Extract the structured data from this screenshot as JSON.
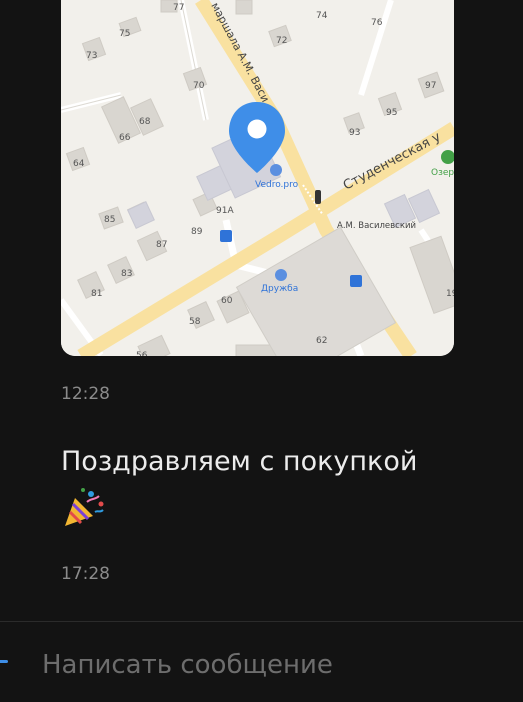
{
  "messages": [
    {
      "type": "location",
      "time": "12:28",
      "map": {
        "street_label": "Студенческая у",
        "vertical_street_label": "маршала А.М. Васи",
        "houses": [
          "77",
          "74",
          "76",
          "75",
          "73",
          "72",
          "70",
          "97",
          "68",
          "66",
          "95",
          "93",
          "64",
          "85",
          "91A",
          "89",
          "87",
          "83",
          "81",
          "60",
          "58",
          "56",
          "62",
          "19"
        ],
        "poi": [
          {
            "name": "Vedro.pro"
          },
          {
            "name": "Дружба"
          },
          {
            "name": "А.М. Василевский"
          },
          {
            "name": "Озер"
          }
        ],
        "pin_color": "#3f8ee8"
      }
    },
    {
      "type": "text",
      "text": "Поздравляем с покупкой",
      "emoji_icon": "party-popper-icon",
      "time": "17:28"
    }
  ],
  "composer": {
    "placeholder": "Написать сообщение"
  }
}
